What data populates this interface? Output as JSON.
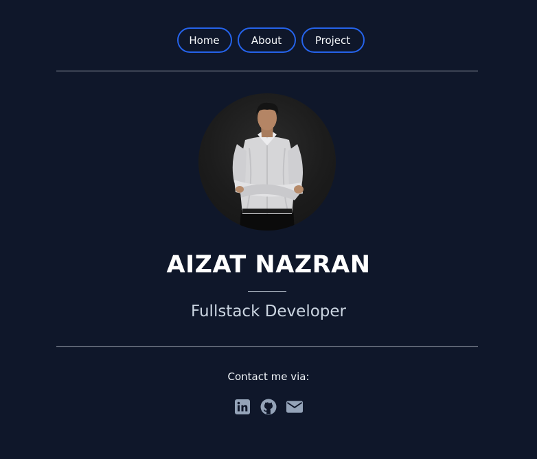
{
  "nav": {
    "home_label": "Home",
    "about_label": "About",
    "project_label": "Project"
  },
  "profile": {
    "photo_icon": "profile-photo",
    "name": "AIZAT NAZRAN",
    "role": "Fullstack Developer"
  },
  "contact": {
    "label": "Contact me via:",
    "icons": [
      "linkedin-icon",
      "github-icon",
      "email-icon"
    ]
  },
  "colors": {
    "background": "#0f172a",
    "button_border": "#2563eb",
    "icon": "#94a3b8",
    "divider": "#9ca3af"
  }
}
